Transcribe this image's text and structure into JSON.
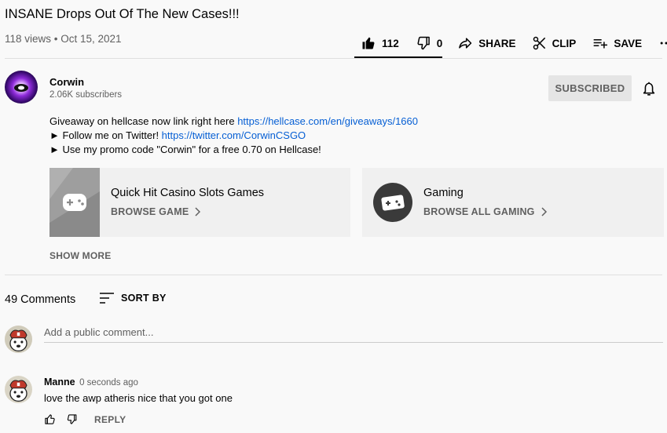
{
  "video": {
    "title": "INSANE Drops Out Of The New Cases!!!",
    "meta": "118 views • Oct 15, 2021",
    "like_count": "112",
    "dislike_count": "0",
    "share_label": "SHARE",
    "clip_label": "CLIP",
    "save_label": "SAVE"
  },
  "channel": {
    "name": "Corwin",
    "subscribers": "2.06K subscribers",
    "subscribe_label": "SUBSCRIBED"
  },
  "description": {
    "line1_text": "Giveaway on hellcase now link right here ",
    "line1_link": "https://hellcase.com/en/giveaways/1660",
    "line2_text": "► Follow me on Twitter! ",
    "line2_link": "https://twitter.com/CorwinCSGO",
    "line3_text": "► Use my promo code \"Corwin\" for a free 0.70 on Hellcase!",
    "show_more": "SHOW MORE"
  },
  "cards": [
    {
      "title": "Quick Hit Casino Slots Games",
      "action": "BROWSE GAME"
    },
    {
      "title": "Gaming",
      "action": "BROWSE ALL GAMING"
    }
  ],
  "comments": {
    "count_label": "49 Comments",
    "sort_label": "SORT BY",
    "placeholder": "Add a public comment...",
    "items": [
      {
        "author": "Manne",
        "time": "0 seconds ago",
        "text": "love the awp atheris nice that you got one",
        "reply_label": "REPLY"
      }
    ]
  },
  "colors": {
    "link": "#065fd4",
    "secondary_text": "#606060",
    "subscribed_bg": "#e5e5e5"
  }
}
